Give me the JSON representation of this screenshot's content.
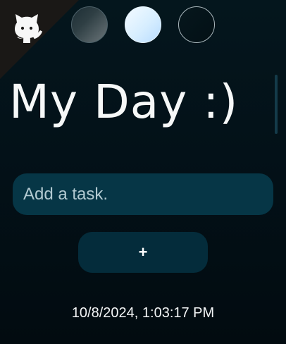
{
  "header": {
    "github_icon": "github-octocat-icon",
    "theme_swatches": [
      {
        "name": "theme-1",
        "colors": [
          "#1d2e35",
          "#6b7579"
        ]
      },
      {
        "name": "theme-2",
        "colors": [
          "#f4fbff",
          "#b8dcff"
        ]
      },
      {
        "name": "theme-3",
        "colors": [
          "#06171d",
          "#031015"
        ]
      }
    ]
  },
  "main": {
    "title": "My Day :)",
    "task_input": {
      "placeholder": "Add a task.",
      "value": ""
    },
    "add_button_label": "+",
    "datetime": "10/8/2024, 1:03:17 PM"
  }
}
